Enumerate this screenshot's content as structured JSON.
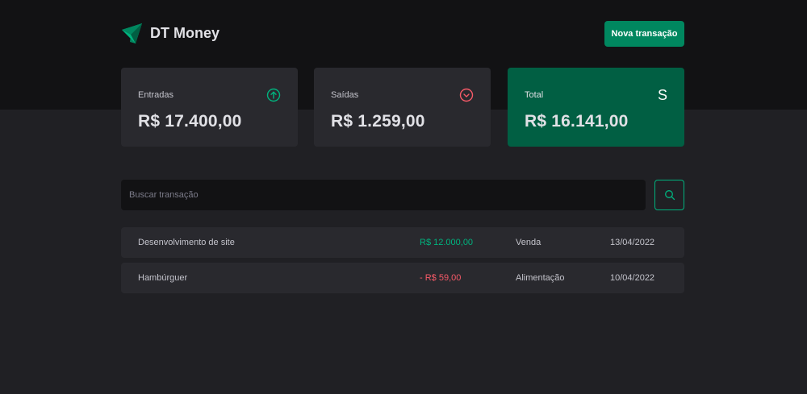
{
  "app": {
    "name": "DT Money",
    "new_transaction_label": "Nova transação"
  },
  "summary": {
    "income": {
      "label": "Entradas",
      "value": "R$ 17.400,00",
      "icon": "arrow-circle-up-icon"
    },
    "outcome": {
      "label": "Saídas",
      "value": "R$ 1.259,00",
      "icon": "arrow-circle-down-icon"
    },
    "total": {
      "label": "Total",
      "value": "R$ 16.141,00",
      "icon_text": "S"
    }
  },
  "search": {
    "placeholder": "Buscar transação",
    "button_icon": "magnifying-glass-icon"
  },
  "transactions": [
    {
      "description": "Desenvolvimento de site",
      "price": "R$ 12.000,00",
      "type": "income",
      "category": "Venda",
      "date": "13/04/2022"
    },
    {
      "description": "Hambúrguer",
      "price": "- R$ 59,00",
      "type": "outcome",
      "category": "Alimentação",
      "date": "10/04/2022"
    }
  ],
  "colors": {
    "brand": "#00875f",
    "brand_dark": "#015f43",
    "income": "#00b37e",
    "outcome": "#f75a68",
    "background": "#202024",
    "header": "#121214",
    "card": "#29292e"
  }
}
